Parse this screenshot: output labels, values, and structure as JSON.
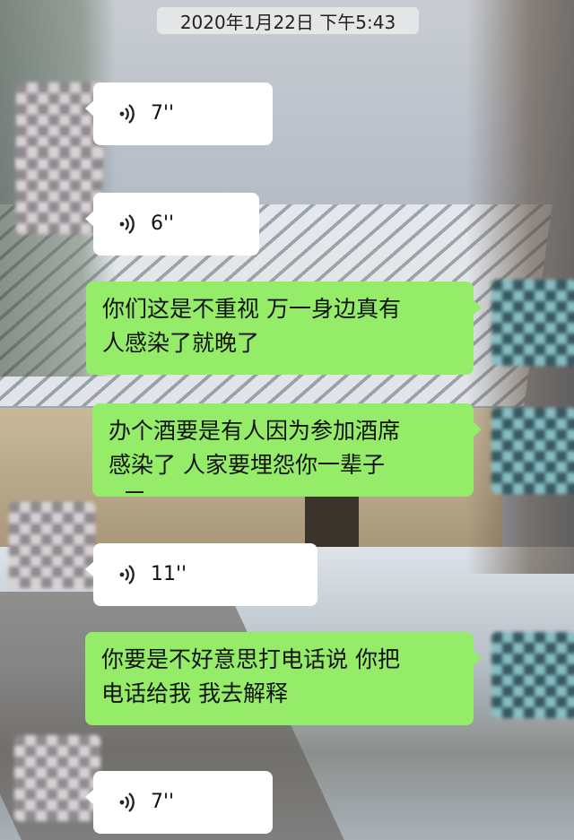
{
  "chat": {
    "timestamp": "2020年1月22日 下午5:43",
    "messages": [
      {
        "side": "left",
        "type": "voice",
        "duration": "7''"
      },
      {
        "side": "left",
        "type": "voice",
        "duration": "6''"
      },
      {
        "side": "right",
        "type": "text",
        "lines": [
          "你们这是不重视 万一身边真有",
          "人感染了就晚了"
        ]
      },
      {
        "side": "right",
        "type": "text",
        "lines": [
          "办个酒要是有人因为参加酒席",
          "感染了 人家要埋怨你一辈子"
        ]
      },
      {
        "side": "left",
        "type": "voice",
        "duration": "11''"
      },
      {
        "side": "right",
        "type": "text",
        "lines": [
          "你要是不好意思打电话说 你把",
          "电话给我 我去解释"
        ]
      },
      {
        "side": "left",
        "type": "voice",
        "duration": "7''"
      }
    ]
  },
  "colors": {
    "sent_bubble": "#95ec69",
    "received_bubble": "#ffffff"
  },
  "icons": {
    "voice": "voice-wave-icon"
  }
}
